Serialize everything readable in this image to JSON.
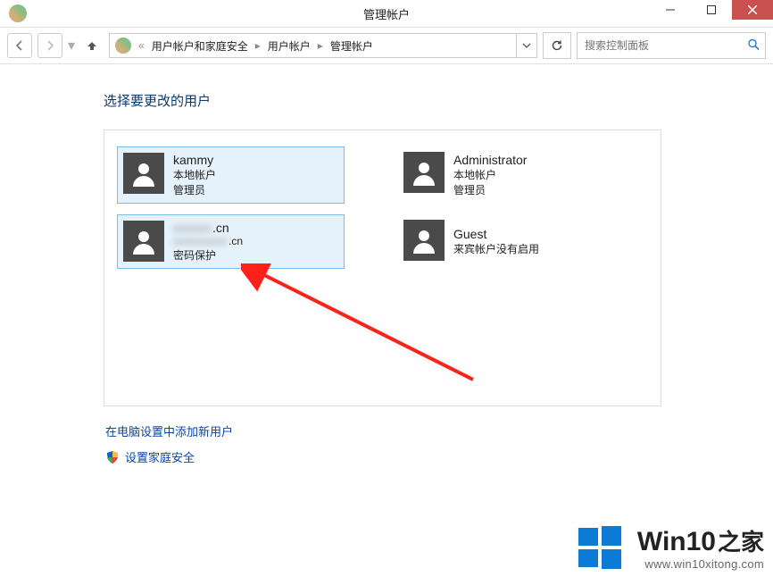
{
  "window": {
    "title": "管理帐户"
  },
  "nav": {
    "back_sep": "«",
    "breadcrumb": {
      "a": "用户帐户和家庭安全",
      "b": "用户帐户",
      "c": "管理帐户"
    },
    "search_placeholder": "搜索控制面板"
  },
  "content": {
    "heading": "选择要更改的用户",
    "accounts": [
      {
        "name": "kammy",
        "line1": "本地帐户",
        "line2": "管理员"
      },
      {
        "name": "Administrator",
        "line1": "本地帐户",
        "line2": "管理员"
      },
      {
        "obscured_tail": ".cn",
        "line1": "密码保护"
      },
      {
        "name": "Guest",
        "line1": "来宾帐户没有启用"
      }
    ],
    "links": {
      "add_user": "在电脑设置中添加新用户",
      "family_safety": "设置家庭安全"
    }
  },
  "watermark": {
    "big_en": "Win10",
    "big_zh": "之家",
    "url": "www.win10xitong.com"
  }
}
